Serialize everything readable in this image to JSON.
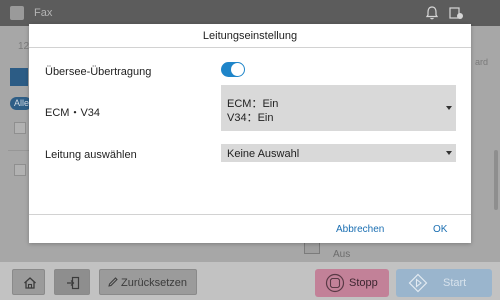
{
  "app": {
    "title": "Fax"
  },
  "background": {
    "time_text": "12:",
    "filter_pill": "Alle",
    "right_edge_text": "ard",
    "right_item_value": "Aus"
  },
  "dialog": {
    "title": "Leitungseinstellung",
    "overseas": {
      "label": "Übersee-Übertragung",
      "enabled": true
    },
    "ecm": {
      "label": "ECM・V34",
      "value_line1": "ECM：Ein",
      "value_line2": "V34：Ein"
    },
    "line_select": {
      "label": "Leitung auswählen",
      "value": "Keine Auswahl"
    },
    "cancel_label": "Abbrechen",
    "ok_label": "OK"
  },
  "bottom_bar": {
    "reset_label": "Zurücksetzen",
    "stop_label": "Stopp",
    "start_label": "Start"
  },
  "colors": {
    "accent": "#1f85c9",
    "stop": "#c28198",
    "start": "#9ab5cd"
  },
  "icons": {
    "bell": "bell-icon",
    "status": "status-icon",
    "home": "home-icon",
    "logout": "logout-icon",
    "pencil": "pencil-icon",
    "stop": "stop-icon",
    "start": "start-icon"
  }
}
